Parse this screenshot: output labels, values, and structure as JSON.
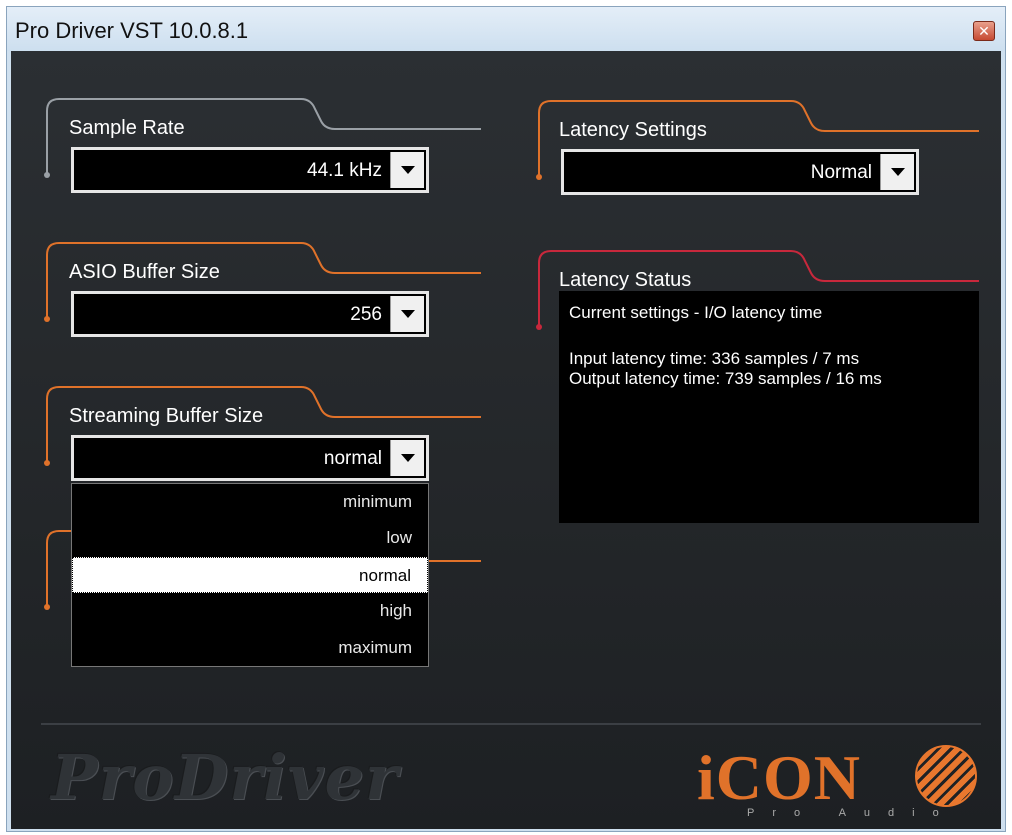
{
  "window": {
    "title": "Pro Driver VST 10.0.8.1",
    "close_glyph": "✕"
  },
  "sample_rate": {
    "label": "Sample Rate",
    "value": "44.1 kHz"
  },
  "asio_buffer": {
    "label": "ASIO Buffer Size",
    "value": "256"
  },
  "streaming_buffer": {
    "label": "Streaming Buffer Size",
    "value": "normal",
    "options": [
      "minimum",
      "low",
      "normal",
      "high",
      "maximum"
    ],
    "selected_index": 2
  },
  "latency_settings": {
    "label": "Latency Settings",
    "value": "Normal"
  },
  "latency_status": {
    "label": "Latency Status",
    "line1": "Current settings - I/O latency time",
    "line2": "Input latency time: 336 samples / 7 ms",
    "line3": "Output latency time: 739 samples / 16 ms"
  },
  "footer": {
    "prodriver_logo": "ProDriver",
    "icon_logo": "iCON",
    "icon_sub": "Pro Audio"
  },
  "colors": {
    "panel_bg": "#232629",
    "accent_orange": "#e0722a",
    "accent_red": "#c8283c",
    "accent_grey": "#9aa0a6"
  },
  "icons": {
    "close": "close-icon",
    "dropdown": "chevron-down-icon"
  }
}
